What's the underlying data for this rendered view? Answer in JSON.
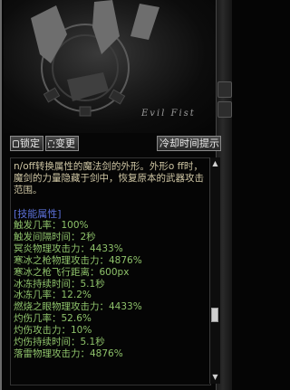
{
  "banner": {
    "logo_text": "Evil Fist"
  },
  "toolbar": {
    "lock_label": "锁定",
    "unlock_label": "变更",
    "hint_label": "冷却时间提示"
  },
  "skill": {
    "description": "n/off转换属性的魔法剑的外形。外形o ff时，魔剑的力量隐藏于剑中，恢复原本的武器攻击范围。",
    "section_title": "[技能属性]",
    "attributes": [
      "触发几率：100%",
      "触发间隔时间：2秒",
      "冥炎物理攻击力：4433%",
      "寒冰之枪物理攻击力：4876%",
      "寒冰之枪飞行距离：600px",
      "冰冻持续时间：5.1秒",
      "冰冻几率：12.2%",
      "燃烧之眼物理攻击力：4433%",
      "灼伤几率：52.6%",
      "灼伤攻击力：10%",
      "灼伤持续时间：5.1秒",
      "落雷物理攻击力：4876%"
    ]
  },
  "scrollbar": {
    "up_arrow": "▲",
    "down_arrow": "▼"
  }
}
